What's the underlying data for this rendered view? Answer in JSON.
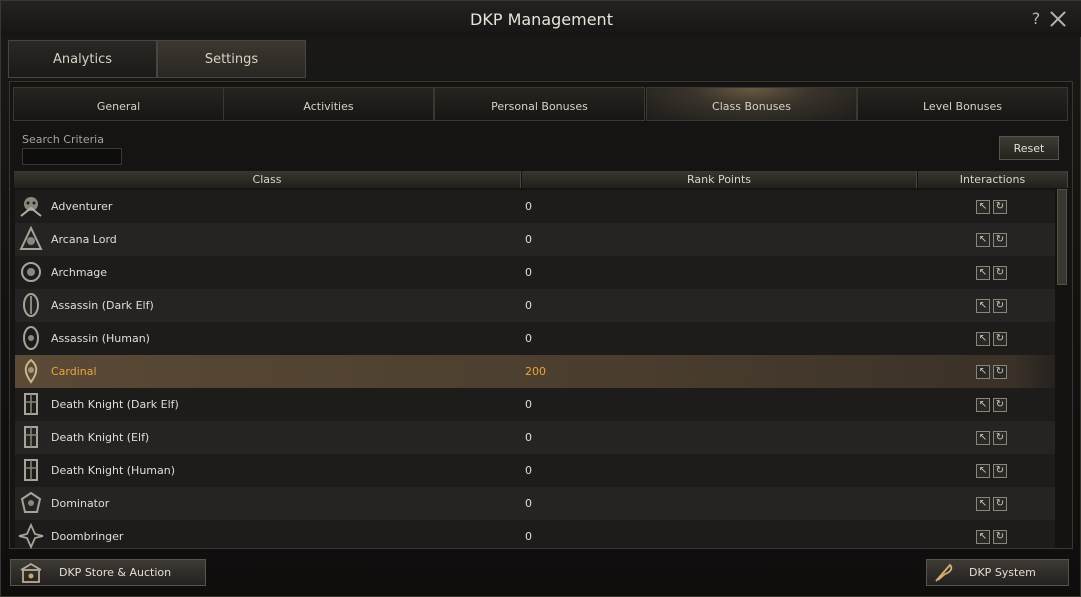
{
  "window": {
    "title": "DKP Management",
    "help_icon": "?",
    "close_icon": "close-icon"
  },
  "main_tabs": [
    {
      "label": "Analytics",
      "active": false
    },
    {
      "label": "Settings",
      "active": true
    }
  ],
  "sub_tabs": [
    {
      "label": "General",
      "active": false
    },
    {
      "label": "Activities",
      "active": false
    },
    {
      "label": "Personal Bonuses",
      "active": false
    },
    {
      "label": "Class Bonuses",
      "active": true
    },
    {
      "label": "Level Bonuses",
      "active": false
    }
  ],
  "search": {
    "label": "Search Criteria",
    "value": "",
    "placeholder": ""
  },
  "reset_label": "Reset",
  "table": {
    "headers": {
      "class": "Class",
      "rank_points": "Rank Points",
      "interactions": "Interactions"
    },
    "rows": [
      {
        "name": "Adventurer",
        "points": "0",
        "icon": "adventurer-class-icon"
      },
      {
        "name": "Arcana Lord",
        "points": "0",
        "icon": "arcana-lord-class-icon"
      },
      {
        "name": "Archmage",
        "points": "0",
        "icon": "archmage-class-icon"
      },
      {
        "name": "Assassin (Dark Elf)",
        "points": "0",
        "icon": "assassin-dark-elf-class-icon"
      },
      {
        "name": "Assassin (Human)",
        "points": "0",
        "icon": "assassin-human-class-icon"
      },
      {
        "name": "Cardinal",
        "points": "200",
        "icon": "cardinal-class-icon",
        "selected": true
      },
      {
        "name": "Death Knight (Dark Elf)",
        "points": "0",
        "icon": "death-knight-dark-elf-class-icon"
      },
      {
        "name": "Death Knight (Elf)",
        "points": "0",
        "icon": "death-knight-elf-class-icon"
      },
      {
        "name": "Death Knight (Human)",
        "points": "0",
        "icon": "death-knight-human-class-icon"
      },
      {
        "name": "Dominator",
        "points": "0",
        "icon": "dominator-class-icon"
      },
      {
        "name": "Doombringer",
        "points": "0",
        "icon": "doombringer-class-icon"
      }
    ],
    "row_actions": [
      "edit-icon",
      "reset-icon"
    ]
  },
  "bottom": {
    "store_label": "DKP Store & Auction",
    "system_label": "DKP System"
  },
  "colors": {
    "selected_text": "#e9a53c",
    "background": "#151412"
  }
}
